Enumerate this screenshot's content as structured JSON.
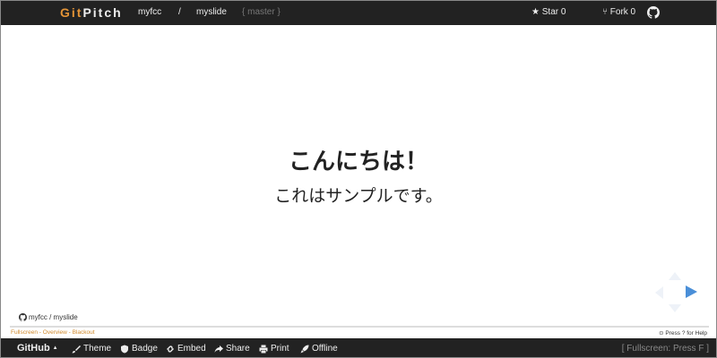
{
  "header": {
    "brand_git": "Git",
    "brand_pitch": "Pitch",
    "user": "myfcc",
    "separator": "/",
    "repo": "myslide",
    "branch": "{ master }",
    "star_label": "★ Star 0",
    "fork_label": "Fork 0"
  },
  "slide": {
    "heading": "こんにちは！",
    "subheading": "これはサンプルです。",
    "repo_link": "myfcc / myslide"
  },
  "menu": {
    "fullscreen": "Fullscreen",
    "overview": "Overview",
    "blackout": "Blackout",
    "sep": " - ",
    "help": "⊙ Press ? for Help"
  },
  "footer": {
    "github": "GitHub",
    "caret": "▲",
    "theme": "Theme",
    "badge": "Badge",
    "embed": "Embed",
    "share": "Share",
    "print": "Print",
    "offline": "Offline",
    "fullscreen_hint": "[ Fullscreen: Press F ]"
  },
  "colors": {
    "bar_bg": "#222222",
    "brand_accent": "#e49436",
    "menu_link": "#d08a2d",
    "nav_arrow": "#4a8fd8"
  }
}
